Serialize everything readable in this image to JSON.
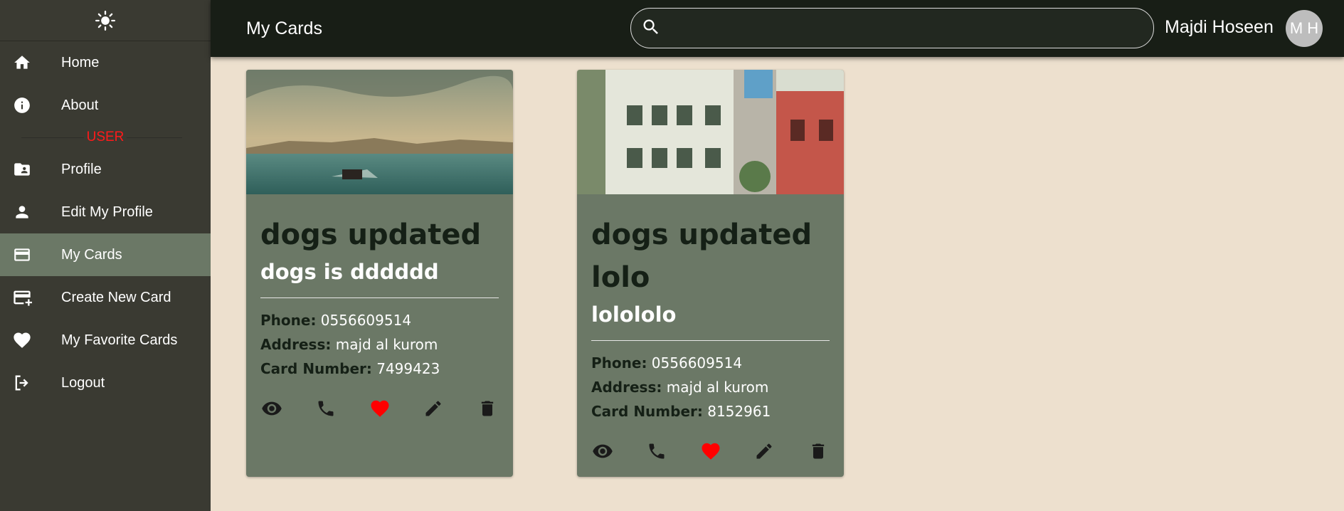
{
  "sidebar": {
    "theme_icon": "sun-icon",
    "items": [
      {
        "label": "Home",
        "icon": "home-icon"
      },
      {
        "label": "About",
        "icon": "info-icon"
      },
      {
        "label": "Profile",
        "icon": "profile-folder-icon"
      },
      {
        "label": "Edit My Profile",
        "icon": "person-icon"
      },
      {
        "label": "My Cards",
        "icon": "credit-card-icon",
        "active": true
      },
      {
        "label": "Create New Card",
        "icon": "add-card-icon"
      },
      {
        "label": "My Favorite Cards",
        "icon": "heart-icon"
      },
      {
        "label": "Logout",
        "icon": "logout-icon"
      }
    ],
    "section_user": "USER"
  },
  "header": {
    "title": "My Cards",
    "search_placeholder": "",
    "username": "Majdi Hoseen",
    "avatar_initials": "M H"
  },
  "cards": [
    {
      "title": "dogs updated",
      "subtitle": "dogs is dddddd",
      "phone_label": "Phone:",
      "phone": "0556609514",
      "address_label": "Address:",
      "address": "majd al kurom",
      "card_number_label": "Card Number:",
      "card_number": "7499423",
      "favorited": true
    },
    {
      "title": "dogs updated lolo",
      "subtitle": "lolololo",
      "phone_label": "Phone:",
      "phone": "0556609514",
      "address_label": "Address:",
      "address": "majd al kurom",
      "card_number_label": "Card Number:",
      "card_number": "8152961",
      "favorited": true
    }
  ],
  "colors": {
    "sidebar_bg": "#3a3a32",
    "topbar_bg": "#181e16",
    "card_bg": "#6b7866",
    "page_bg": "#ede0ce",
    "favorite": "#ff0000",
    "user_section": "#ff1a1a"
  }
}
